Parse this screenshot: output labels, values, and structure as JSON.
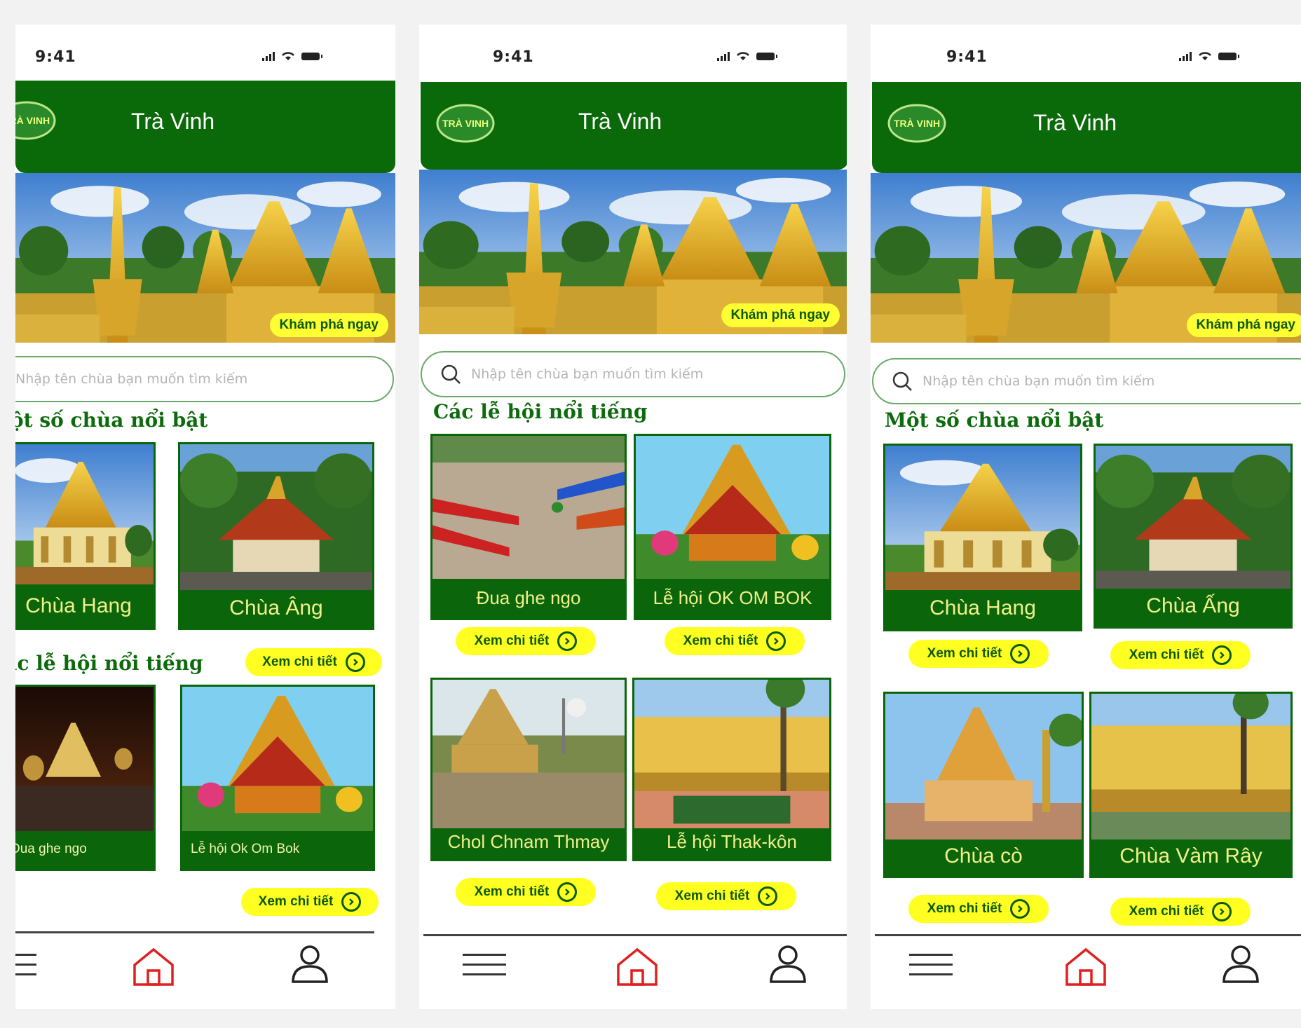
{
  "status": {
    "time": "9:41"
  },
  "header": {
    "title": "Trà Vinh",
    "logo_text": "TRÀ VINH"
  },
  "hero": {
    "cta_label": "Khám phá ngay"
  },
  "search": {
    "placeholder": "Nhập tên chùa bạn muốn tìm kiếm"
  },
  "screen1": {
    "section_temples": "Một số chùa nổi bật",
    "section_festivals": "Các lễ hội nổi tiếng",
    "temples": [
      {
        "label": "Chùa Hang"
      },
      {
        "label": "Chùa Âng"
      }
    ],
    "festivals": [
      {
        "label": "Đua ghe ngo"
      },
      {
        "label": "Lễ hội Ok Om Bok"
      }
    ],
    "detail_label": "Xem chi tiết"
  },
  "screen2": {
    "section_festivals": "Các lễ hội nổi tiếng",
    "festivals": [
      {
        "label": "Đua ghe ngo"
      },
      {
        "label": "Lễ hội OK OM BOK"
      },
      {
        "label": "Chol Chnam Thmay"
      },
      {
        "label": "Lễ hội Thak-kôn"
      }
    ],
    "detail_label": "Xem chi tiết"
  },
  "screen3": {
    "section_temples": "Một số chùa nổi bật",
    "temples": [
      {
        "label": "Chùa Hang"
      },
      {
        "label": "Chùa Ấng"
      },
      {
        "label": "Chùa cò"
      },
      {
        "label": "Chùa Vàm Rây"
      }
    ],
    "detail_label": "Xem chi tiết"
  },
  "colors": {
    "header_green": "#0a6a0a",
    "button_yellow": "#ffff22",
    "label_yellow": "#f0f08a",
    "home_icon_red": "#e02020"
  },
  "icons": {
    "menu": "hamburger-icon",
    "home": "home-icon",
    "profile": "user-icon",
    "search": "search-icon",
    "detail": "chevron-right-circle-icon"
  }
}
